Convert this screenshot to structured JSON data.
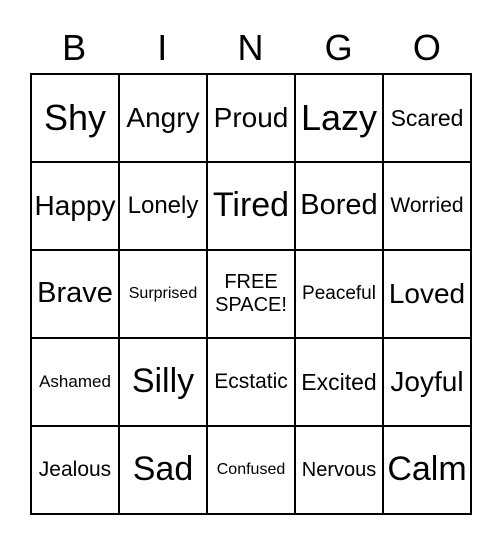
{
  "header": [
    "B",
    "I",
    "N",
    "G",
    "O"
  ],
  "cells": [
    "Shy",
    "Angry",
    "Proud",
    "Lazy",
    "Scared",
    "Happy",
    "Lonely",
    "Tired",
    "Bored",
    "Worried",
    "Brave",
    "Surprised",
    "FREE\nSPACE!",
    "Peaceful",
    "Loved",
    "Ashamed",
    "Silly",
    "Ecstatic",
    "Excited",
    "Joyful",
    "Jealous",
    "Sad",
    "Confused",
    "Nervous",
    "Calm"
  ]
}
